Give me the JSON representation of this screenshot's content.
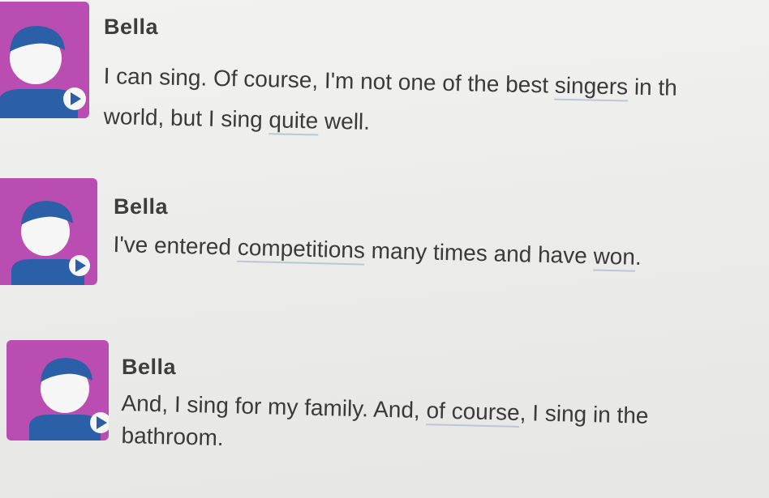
{
  "messages": [
    {
      "speaker": "Bella",
      "lines": [
        [
          {
            "text": "I can sing. Of course, I'm not one of the best "
          },
          {
            "text": "singers",
            "vocab": true
          },
          {
            "text": " in th"
          }
        ],
        [
          {
            "text": "world, but I sing "
          },
          {
            "text": "quite",
            "vocab": true
          },
          {
            "text": " well."
          }
        ]
      ]
    },
    {
      "speaker": "Bella",
      "lines": [
        [
          {
            "text": "I've entered "
          },
          {
            "text": "competitions",
            "vocab": true
          },
          {
            "text": " many times and have "
          },
          {
            "text": "won",
            "vocab": true
          },
          {
            "text": "."
          }
        ]
      ]
    },
    {
      "speaker": "Bella",
      "lines": [
        [
          {
            "text": "And, I sing for my family. And, "
          },
          {
            "text": "of course",
            "vocab": true
          },
          {
            "text": ", I sing in the"
          }
        ],
        [
          {
            "text": "bathroom."
          }
        ]
      ]
    }
  ],
  "colors": {
    "avatar_bg": "#b94db2",
    "avatar_hair": "#2b5fa8",
    "avatar_face": "#f6f6f6",
    "avatar_body": "#2b5fa8",
    "vocab_underline": "#b9c7d6"
  },
  "icons": {
    "avatar": "user-avatar-icon",
    "play": "play-icon"
  }
}
